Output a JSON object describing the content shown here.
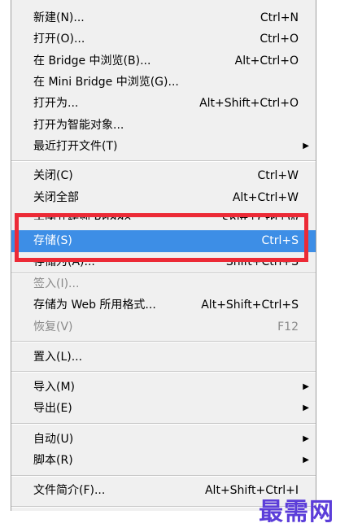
{
  "menu": {
    "items": [
      {
        "label": "新建(N)...",
        "shortcut": "Ctrl+N"
      },
      {
        "label": "打开(O)...",
        "shortcut": "Ctrl+O"
      },
      {
        "label": "在 Bridge 中浏览(B)...",
        "shortcut": "Alt+Ctrl+O"
      },
      {
        "label": "在 Mini Bridge 中浏览(G)...",
        "shortcut": ""
      },
      {
        "label": "打开为...",
        "shortcut": "Alt+Shift+Ctrl+O"
      },
      {
        "label": "打开为智能对象...",
        "shortcut": ""
      },
      {
        "label": "最近打开文件(T)",
        "shortcut": ""
      },
      {
        "label": "关闭(C)",
        "shortcut": "Ctrl+W"
      },
      {
        "label": "关闭全部",
        "shortcut": "Alt+Ctrl+W"
      },
      {
        "label": "关闭并转到 Bridge...",
        "shortcut": "Shift+Ctrl+W"
      },
      {
        "label": "存储(S)",
        "shortcut": "Ctrl+S"
      },
      {
        "label": "存储为(A)...",
        "shortcut": "Shift+Ctrl+S"
      },
      {
        "label": "签入(I)...",
        "shortcut": ""
      },
      {
        "label": "存储为 Web 所用格式...",
        "shortcut": "Alt+Shift+Ctrl+S"
      },
      {
        "label": "恢复(V)",
        "shortcut": "F12"
      },
      {
        "label": "置入(L)...",
        "shortcut": ""
      },
      {
        "label": "导入(M)",
        "shortcut": ""
      },
      {
        "label": "导出(E)",
        "shortcut": ""
      },
      {
        "label": "自动(U)",
        "shortcut": ""
      },
      {
        "label": "脚本(R)",
        "shortcut": ""
      },
      {
        "label": "文件简介(F)...",
        "shortcut": "Alt+Shift+Ctrl+I"
      }
    ],
    "submenu_arrow": "▶"
  },
  "watermark": "最需网",
  "colors": {
    "highlight": "#3d8ee6",
    "annotation_box": "#ec2a36",
    "watermark": "#5b3dd9",
    "menu_bg": "#f0f0f0",
    "disabled_text": "#8a8a8a"
  }
}
